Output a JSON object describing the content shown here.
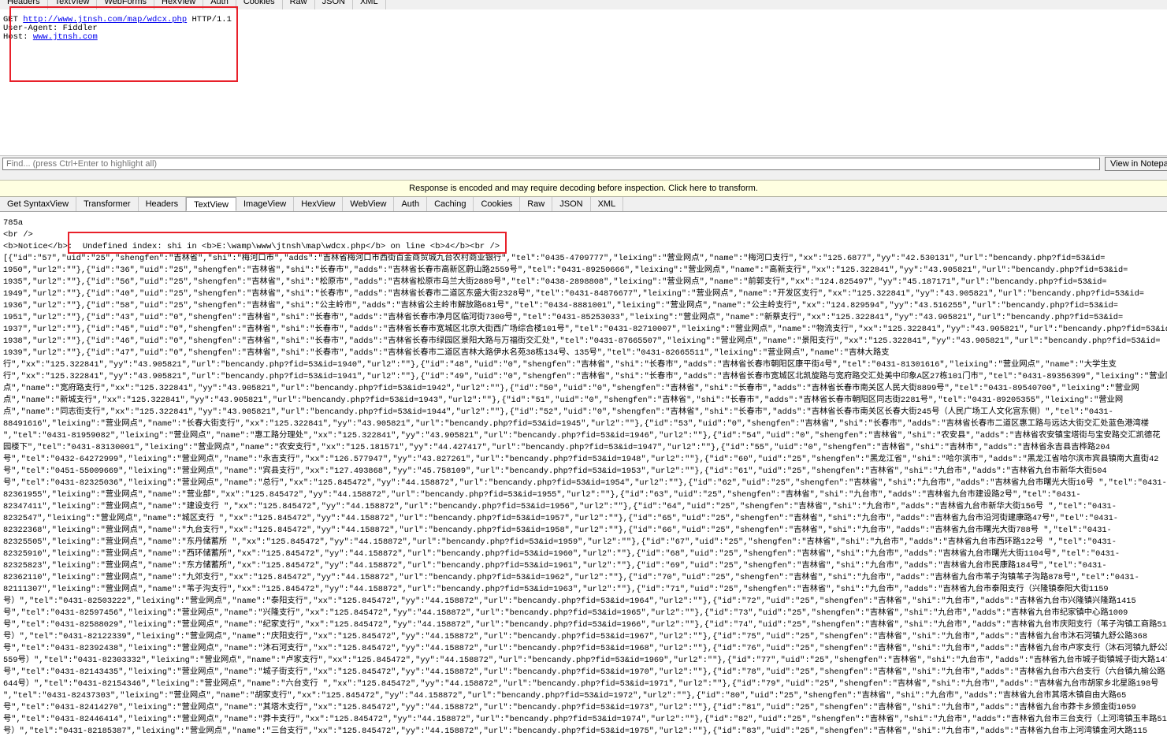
{
  "request_tabs": [
    "Headers",
    "TextView",
    "WebForms",
    "HexView",
    "Auth",
    "Cookies",
    "Raw",
    "JSON",
    "XML"
  ],
  "request": {
    "method": "GET",
    "url": "http://www.jtnsh.com/map/wdcx.php",
    "protocol": "HTTP/1.1",
    "user_agent_line": "User-Agent: Fiddler",
    "host_label": "Host:",
    "host": "www.jtnsh.com"
  },
  "find": {
    "placeholder": "Find... (press Ctrl+Enter to highlight all)",
    "view_button": "View in Notepad"
  },
  "notice_bar": "Response is encoded and may require decoding before inspection. Click here to transform.",
  "response_tabs": [
    "Get SyntaxView",
    "Transformer",
    "Headers",
    "TextView",
    "ImageView",
    "HexView",
    "WebView",
    "Auth",
    "Caching",
    "Cookies",
    "Raw",
    "JSON",
    "XML"
  ],
  "response_active_tab": "TextView",
  "response": {
    "line1": "785a",
    "line2": "<br />",
    "notice": "<b>Notice</b>:  Undefined index: shi in <b>E:\\wamp\\www\\jtnsh\\map\\wdcx.php</b> on line <b>4</b><br />",
    "json_lines": [
      "[{\"id\":\"57\",\"uid\":\"25\",\"shengfen\":\"吉林省\",\"shi\":\"梅河口市\",\"adds\":\"吉林省梅河口市西街百金商贸城九台农村商业银行\",\"tel\":\"0435-4709777\",\"leixing\":\"营业网点\",\"name\":\"梅河口支行\",\"xx\":\"125.6877\",\"yy\":\"42.530131\",\"url\":\"bencandy.php?fid=53&id=",
      "1950\",\"url2\":\"\"},{\"id\":\"36\",\"uid\":\"25\",\"shengfen\":\"吉林省\",\"shi\":\"长春市\",\"adds\":\"吉林省长春市高新区蔚山路2559号\",\"tel\":\"0431-89250666\",\"leixing\":\"营业网点\",\"name\":\"高新支行\",\"xx\":\"125.322841\",\"yy\":\"43.905821\",\"url\":\"bencandy.php?fid=53&id=",
      "1935\",\"url2\":\"\"},{\"id\":\"56\",\"uid\":\"25\",\"shengfen\":\"吉林省\",\"shi\":\"松原市\",\"adds\":\"吉林省松原市乌兰大街2889号\",\"tel\":\"0438-2898808\",\"leixing\":\"营业网点\",\"name\":\"前郭支行\",\"xx\":\"124.825497\",\"yy\":\"45.187171\",\"url\":\"bencandy.php?fid=53&id=",
      "1949\",\"url2\":\"\"},{\"id\":\"40\",\"uid\":\"25\",\"shengfen\":\"吉林省\",\"shi\":\"长春市\",\"adds\":\"吉林省长春市二道区东盛大街2328号\",\"tel\":\"0431-84876677\",\"leixing\":\"营业网点\",\"name\":\"开发区支行\",\"xx\":\"125.322841\",\"yy\":\"43.905821\",\"url\":\"bencandy.php?fid=53&id=",
      "1936\",\"url2\":\"\"},{\"id\":\"58\",\"uid\":\"25\",\"shengfen\":\"吉林省\",\"shi\":\"公主岭市\",\"adds\":\"吉林省公主岭市解放路681号\",\"tel\":\"0434-8881001\",\"leixing\":\"营业网点\",\"name\":\"公主岭支行\",\"xx\":\"124.829594\",\"yy\":\"43.516255\",\"url\":\"bencandy.php?fid=53&id=",
      "1951\",\"url2\":\"\"},{\"id\":\"43\",\"uid\":\"0\",\"shengfen\":\"吉林省\",\"shi\":\"长春市\",\"adds\":\"吉林省长春市净月区临河街7300号\",\"tel\":\"0431-85253033\",\"leixing\":\"营业网点\",\"name\":\"新蔡支行\",\"xx\":\"125.322841\",\"yy\":\"43.905821\",\"url\":\"bencandy.php?fid=53&id=",
      "1937\",\"url2\":\"\"},{\"id\":\"45\",\"uid\":\"0\",\"shengfen\":\"吉林省\",\"shi\":\"长春市\",\"adds\":\"吉林省长春市宽城区北京大街西广场综合楼101号\",\"tel\":\"0431-82710007\",\"leixing\":\"营业网点\",\"name\":\"物流支行\",\"xx\":\"125.322841\",\"yy\":\"43.905821\",\"url\":\"bencandy.php?fid=53&id=",
      "1938\",\"url2\":\"\"},{\"id\":\"46\",\"uid\":\"0\",\"shengfen\":\"吉林省\",\"shi\":\"长春市\",\"adds\":\"吉林省长春市绿园区景阳大路与万福街交汇处\",\"tel\":\"0431-87665507\",\"leixing\":\"营业网点\",\"name\":\"景阳支行\",\"xx\":\"125.322841\",\"yy\":\"43.905821\",\"url\":\"bencandy.php?fid=53&id=",
      "1939\",\"url2\":\"\"},{\"id\":\"47\",\"uid\":\"0\",\"shengfen\":\"吉林省\",\"shi\":\"长春市\",\"adds\":\"吉林省长春市二道区吉林大路伊水名苑38栋134号、135号\",\"tel\":\"0431-82665511\",\"leixing\":\"营业网点\",\"name\":\"吉林大路支",
      "行\",\"xx\":\"125.322841\",\"yy\":\"43.905821\",\"url\":\"bencandy.php?fid=53&id=1940\",\"url2\":\"\"},{\"id\":\"48\",\"uid\":\"0\",\"shengfen\":\"吉林省\",\"shi\":\"长春市\",\"adds\":\"吉林省长春市朝阳区康平街4号\",\"tel\":\"0431-81301616\",\"leixing\":\"营业网点\",\"name\":\"大学生支",
      "行\",\"xx\":\"125.322841\",\"yy\":\"43.905821\",\"url\":\"bencandy.php?fid=53&id=1941\",\"url2\":\"\"},{\"id\":\"49\",\"uid\":\"0\",\"shengfen\":\"吉林省\",\"shi\":\"长春市\",\"adds\":\"吉林省长春市宽城区北凯旋路与宽府路交汇处美中印象A区27栋101门市\",\"tel\":\"0431-89356399\",\"leixing\":\"营业网",
      "点\",\"name\":\"宽府路支行\",\"xx\":\"125.322841\",\"yy\":\"43.905821\",\"url\":\"bencandy.php?fid=53&id=1942\",\"url2\":\"\"},{\"id\":\"50\",\"uid\":\"0\",\"shengfen\":\"吉林省\",\"shi\":\"长春市\",\"adds\":\"吉林省长春市南关区人民大街8899号\",\"tel\":\"0431-89540700\",\"leixing\":\"营业网",
      "点\",\"name\":\"新城支行\",\"xx\":\"125.322841\",\"yy\":\"43.905821\",\"url\":\"bencandy.php?fid=53&id=1943\",\"url2\":\"\"},{\"id\":\"51\",\"uid\":\"0\",\"shengfen\":\"吉林省\",\"shi\":\"长春市\",\"adds\":\"吉林省长春市朝阳区同志街2281号\",\"tel\":\"0431-89205355\",\"leixing\":\"营业网",
      "点\",\"name\":\"同志街支行\",\"xx\":\"125.322841\",\"yy\":\"43.905821\",\"url\":\"bencandy.php?fid=53&id=1944\",\"url2\":\"\"},{\"id\":\"52\",\"uid\":\"0\",\"shengfen\":\"吉林省\",\"shi\":\"长春市\",\"adds\":\"吉林省长春市南关区长春大街245号（人民广场工人文化宫东侧）\",\"tel\":\"0431-",
      "88491616\",\"leixing\":\"营业网点\",\"name\":\"长春大街支行\",\"xx\":\"125.322841\",\"yy\":\"43.905821\",\"url\":\"bencandy.php?fid=53&id=1945\",\"url2\":\"\"},{\"id\":\"53\",\"uid\":\"0\",\"shengfen\":\"吉林省\",\"shi\":\"长春市\",\"adds\":\"吉林省长春市二道区惠工路与远达大街交汇处蓝色港湾楼",
      "\",\"tel\":\"0431-81959082\",\"leixing\":\"营业网点\",\"name\":\"惠工路分理处\",\"xx\":\"125.322841\",\"yy\":\"43.905821\",\"url\":\"bencandy.php?fid=53&id=1946\",\"url2\":\"\"},{\"id\":\"54\",\"uid\":\"0\",\"shengfen\":\"吉林省\",\"shi\":\"农安县\",\"adds\":\"吉林省农安镇宝塔街与宝安路交汇凯德花",
      "园楼下\",\"tel\":\"0431-83130001\",\"leixing\":\"营业网点\",\"name\":\"农安支行\",\"xx\":\"125.181571\",\"yy\":\"44.427417\",\"url\":\"bencandy.php?fid=53&id=1947\",\"url2\":\"\"},{\"id\":\"55\",\"uid\":\"0\",\"shengfen\":\"吉林省\",\"shi\":\"吉林市\",\"adds\":\"吉林省永吉县吉桦路204",
      "号\",\"tel\":\"0432-64272999\",\"leixing\":\"营业网点\",\"name\":\"永吉支行\",\"xx\":\"126.577947\",\"yy\":\"43.827261\",\"url\":\"bencandy.php?fid=53&id=1948\",\"url2\":\"\"},{\"id\":\"60\",\"uid\":\"25\",\"shengfen\":\"黑龙江省\",\"shi\":\"哈尔滨市\",\"adds\":\"黑龙江省哈尔滨市宾县镇南大直街42",
      "号\",\"tel\":\"0451-55009669\",\"leixing\":\"营业网点\",\"name\":\"宾县支行\",\"xx\":\"127.493868\",\"yy\":\"45.758109\",\"url\":\"bencandy.php?fid=53&id=1953\",\"url2\":\"\"},{\"id\":\"61\",\"uid\":\"25\",\"shengfen\":\"吉林省\",\"shi\":\"九台市\",\"adds\":\"吉林省九台市新华大街504",
      "号\",\"tel\":\"0431-82325036\",\"leixing\":\"营业网点\",\"name\":\"总行\",\"xx\":\"125.845472\",\"yy\":\"44.158872\",\"url\":\"bencandy.php?fid=53&id=1954\",\"url2\":\"\"},{\"id\":\"62\",\"uid\":\"25\",\"shengfen\":\"吉林省\",\"shi\":\"九台市\",\"adds\":\"吉林省九台市曙光大街16号 \",\"tel\":\"0431-",
      "82361955\",\"leixing\":\"营业网点\",\"name\":\"营业部\",\"xx\":\"125.845472\",\"yy\":\"44.158872\",\"url\":\"bencandy.php?fid=53&id=1955\",\"url2\":\"\"},{\"id\":\"63\",\"uid\":\"25\",\"shengfen\":\"吉林省\",\"shi\":\"九台市\",\"adds\":\"吉林省九台市建设路2号\",\"tel\":\"0431-",
      "82347411\",\"leixing\":\"营业网点\",\"name\":\"建设支行 \",\"xx\":\"125.845472\",\"yy\":\"44.158872\",\"url\":\"bencandy.php?fid=53&id=1956\",\"url2\":\"\"},{\"id\":\"64\",\"uid\":\"25\",\"shengfen\":\"吉林省\",\"shi\":\"九台市\",\"adds\":\"吉林省九台市新华大街156号 \",\"tel\":\"0431-",
      "8232547\",\"leixing\":\"营业网点\",\"name\":\"城区支行 \",\"xx\":\"125.845472\",\"yy\":\"44.158872\",\"url\":\"bencandy.php?fid=53&id=1957\",\"url2\":\"\"},{\"id\":\"65\",\"uid\":\"25\",\"shengfen\":\"吉林省\",\"shi\":\"九台市\",\"adds\":\"吉林省九台市沿河街建康路47号\",\"tel\":\"0431-",
      "82322368\",\"leixing\":\"营业网点\",\"name\":\"九台支行\",\"xx\":\"125.845472\",\"yy\":\"44.158872\",\"url\":\"bencandy.php?fid=53&id=1958\",\"url2\":\"\"},{\"id\":\"66\",\"uid\":\"25\",\"shengfen\":\"吉林省\",\"shi\":\"九台市\",\"adds\":\"吉林省九台市曙光大街788号 \",\"tel\":\"0431-",
      "82325505\",\"leixing\":\"营业网点\",\"name\":\"东丹储蓄所 \",\"xx\":\"125.845472\",\"yy\":\"44.158872\",\"url\":\"bencandy.php?fid=53&id=1959\",\"url2\":\"\"},{\"id\":\"67\",\"uid\":\"25\",\"shengfen\":\"吉林省\",\"shi\":\"九台市\",\"adds\":\"吉林省九台市西环路122号 \",\"tel\":\"0431-",
      "82325910\",\"leixing\":\"营业网点\",\"name\":\"西环储蓄所\",\"xx\":\"125.845472\",\"yy\":\"44.158872\",\"url\":\"bencandy.php?fid=53&id=1960\",\"url2\":\"\"},{\"id\":\"68\",\"uid\":\"25\",\"shengfen\":\"吉林省\",\"shi\":\"九台市\",\"adds\":\"吉林省九台市曙光大街1104号\",\"tel\":\"0431-",
      "82325823\",\"leixing\":\"营业网点\",\"name\":\"东方储蓄所\",\"xx\":\"125.845472\",\"yy\":\"44.158872\",\"url\":\"bencandy.php?fid=53&id=1961\",\"url2\":\"\"},{\"id\":\"69\",\"uid\":\"25\",\"shengfen\":\"吉林省\",\"shi\":\"九台市\",\"adds\":\"吉林省九台市民康路184号\",\"tel\":\"0431-",
      "82362110\",\"leixing\":\"营业网点\",\"name\":\"九郊支行\",\"xx\":\"125.845472\",\"yy\":\"44.158872\",\"url\":\"bencandy.php?fid=53&id=1962\",\"url2\":\"\"},{\"id\":\"70\",\"uid\":\"25\",\"shengfen\":\"吉林省\",\"shi\":\"九台市\",\"adds\":\"吉林省九台市苇子沟镇苇子沟路878号\",\"tel\":\"0431-",
      "82111307\",\"leixing\":\"营业网点\",\"name\":\"苇子沟支行\",\"xx\":\"125.845472\",\"yy\":\"44.158872\",\"url\":\"bencandy.php?fid=53&id=1963\",\"url2\":\"\"},{\"id\":\"71\",\"uid\":\"25\",\"shengfen\":\"吉林省\",\"shi\":\"九台市\",\"adds\":\"吉林省九台市泰阳支行（兴隆镇泰阳大街1159",
      "号）\",\"tel\":\"0431-82503222\",\"leixing\":\"营业网点\",\"name\":\"泰阳支行\",\"xx\":\"125.845472\",\"yy\":\"44.158872\",\"url\":\"bencandy.php?fid=53&id=1964\",\"url2\":\"\"},{\"id\":\"72\",\"uid\":\"25\",\"shengfen\":\"吉林省\",\"shi\":\"九台市\",\"adds\":\"吉林省九台市兴隆镇兴隆路1415",
      "号\",\"tel\":\"0431-82597456\",\"leixing\":\"营业网点\",\"name\":\"兴隆支行\",\"xx\":\"125.845472\",\"yy\":\"44.158872\",\"url\":\"bencandy.php?fid=53&id=1965\",\"url2\":\"\"},{\"id\":\"73\",\"uid\":\"25\",\"shengfen\":\"吉林省\",\"shi\":\"九台市\",\"adds\":\"吉林省九台市纪家镇中心路1009",
      "号\",\"tel\":\"0431-82588029\",\"leixing\":\"营业网点\",\"name\":\"纪家支行\",\"xx\":\"125.845472\",\"yy\":\"44.158872\",\"url\":\"bencandy.php?fid=53&id=1966\",\"url2\":\"\"},{\"id\":\"74\",\"uid\":\"25\",\"shengfen\":\"吉林省\",\"shi\":\"九台市\",\"adds\":\"吉林省九台市庆阳支行（苇子沟镇工商路511",
      "号）\",\"tel\":\"0431-82122339\",\"leixing\":\"营业网点\",\"name\":\"庆阳支行\",\"xx\":\"125.845472\",\"yy\":\"44.158872\",\"url\":\"bencandy.php?fid=53&id=1967\",\"url2\":\"\"},{\"id\":\"75\",\"uid\":\"25\",\"shengfen\":\"吉林省\",\"shi\":\"九台市\",\"adds\":\"吉林省九台市沐石河镇九舒公路368",
      "号\",\"tel\":\"0431-82392438\",\"leixing\":\"营业网点\",\"name\":\"沐石河支行\",\"xx\":\"125.845472\",\"yy\":\"44.158872\",\"url\":\"bencandy.php?fid=53&id=1968\",\"url2\":\"\"},{\"id\":\"76\",\"uid\":\"25\",\"shengfen\":\"吉林省\",\"shi\":\"九台市\",\"adds\":\"吉林省九台市卢家支行（沐石河镇九舒公路",
      "559号）\",\"tel\":\"0431-82303332\",\"leixing\":\"营业网点\",\"name\":\"卢家支行\",\"xx\":\"125.845472\",\"yy\":\"44.158872\",\"url\":\"bencandy.php?fid=53&id=1969\",\"url2\":\"\"},{\"id\":\"77\",\"uid\":\"25\",\"shengfen\":\"吉林省\",\"shi\":\"九台市\",\"adds\":\"吉林省九台市城子街镇城子街大路1478",
      "号\",\"tel\":\"0431-82143435\",\"leixing\":\"营业网点\",\"name\":\"城子街支行\",\"xx\":\"125.845472\",\"yy\":\"44.158872\",\"url\":\"bencandy.php?fid=53&id=1970\",\"url2\":\"\"},{\"id\":\"78\",\"uid\":\"25\",\"shengfen\":\"吉林省\",\"shi\":\"九台市\",\"adds\":\"吉林省九台市六台支行（六台镇九榆公路",
      "644号）\",\"tel\":\"0431-82154346\",\"leixing\":\"营业网点\",\"name\":\"六台支行 \",\"xx\":\"125.845472\",\"yy\":\"44.158872\",\"url\":\"bencandy.php?fid=53&id=1971\",\"url2\":\"\"},{\"id\":\"79\",\"uid\":\"25\",\"shengfen\":\"吉林省\",\"shi\":\"九台市\",\"adds\":\"吉林省九台市胡家乡北星路198号",
      "\",\"tel\":\"0431-82437303\",\"leixing\":\"营业网点\",\"name\":\"胡家支行\",\"xx\":\"125.845472\",\"yy\":\"44.158872\",\"url\":\"bencandy.php?fid=53&id=1972\",\"url2\":\"\"},{\"id\":\"80\",\"uid\":\"25\",\"shengfen\":\"吉林省\",\"shi\":\"九台市\",\"adds\":\"吉林省九台市其塔木镇自由大路65",
      "号\",\"tel\":\"0431-82414270\",\"leixing\":\"营业网点\",\"name\":\"其塔木支行\",\"xx\":\"125.845472\",\"yy\":\"44.158872\",\"url\":\"bencandy.php?fid=53&id=1973\",\"url2\":\"\"},{\"id\":\"81\",\"uid\":\"25\",\"shengfen\":\"吉林省\",\"shi\":\"九台市\",\"adds\":\"吉林省九台市莽卡乡颁金街1059",
      "号\",\"tel\":\"0431-82446414\",\"leixing\":\"营业网点\",\"name\":\"莽卡支行\",\"xx\":\"125.845472\",\"yy\":\"44.158872\",\"url\":\"bencandy.php?fid=53&id=1974\",\"url2\":\"\"},{\"id\":\"82\",\"uid\":\"25\",\"shengfen\":\"吉林省\",\"shi\":\"九台市\",\"adds\":\"吉林省九台市三台支行（上河湾镇玉丰路511",
      "号）\",\"tel\":\"0431-82185387\",\"leixing\":\"营业网点\",\"name\":\"三台支行\",\"xx\":\"125.845472\",\"yy\":\"44.158872\",\"url\":\"bencandy.php?fid=53&id=1975\",\"url2\":\"\"},{\"id\":\"83\",\"uid\":\"25\",\"shengfen\":\"吉林省\",\"shi\":\"九台市\",\"adds\":\"吉林省九台市上河湾镇金河大路115"
    ]
  },
  "colors": {
    "highlight_border": "#e8202a",
    "notice_bar_bg": "#ffffe1",
    "link": "#0000ee"
  }
}
